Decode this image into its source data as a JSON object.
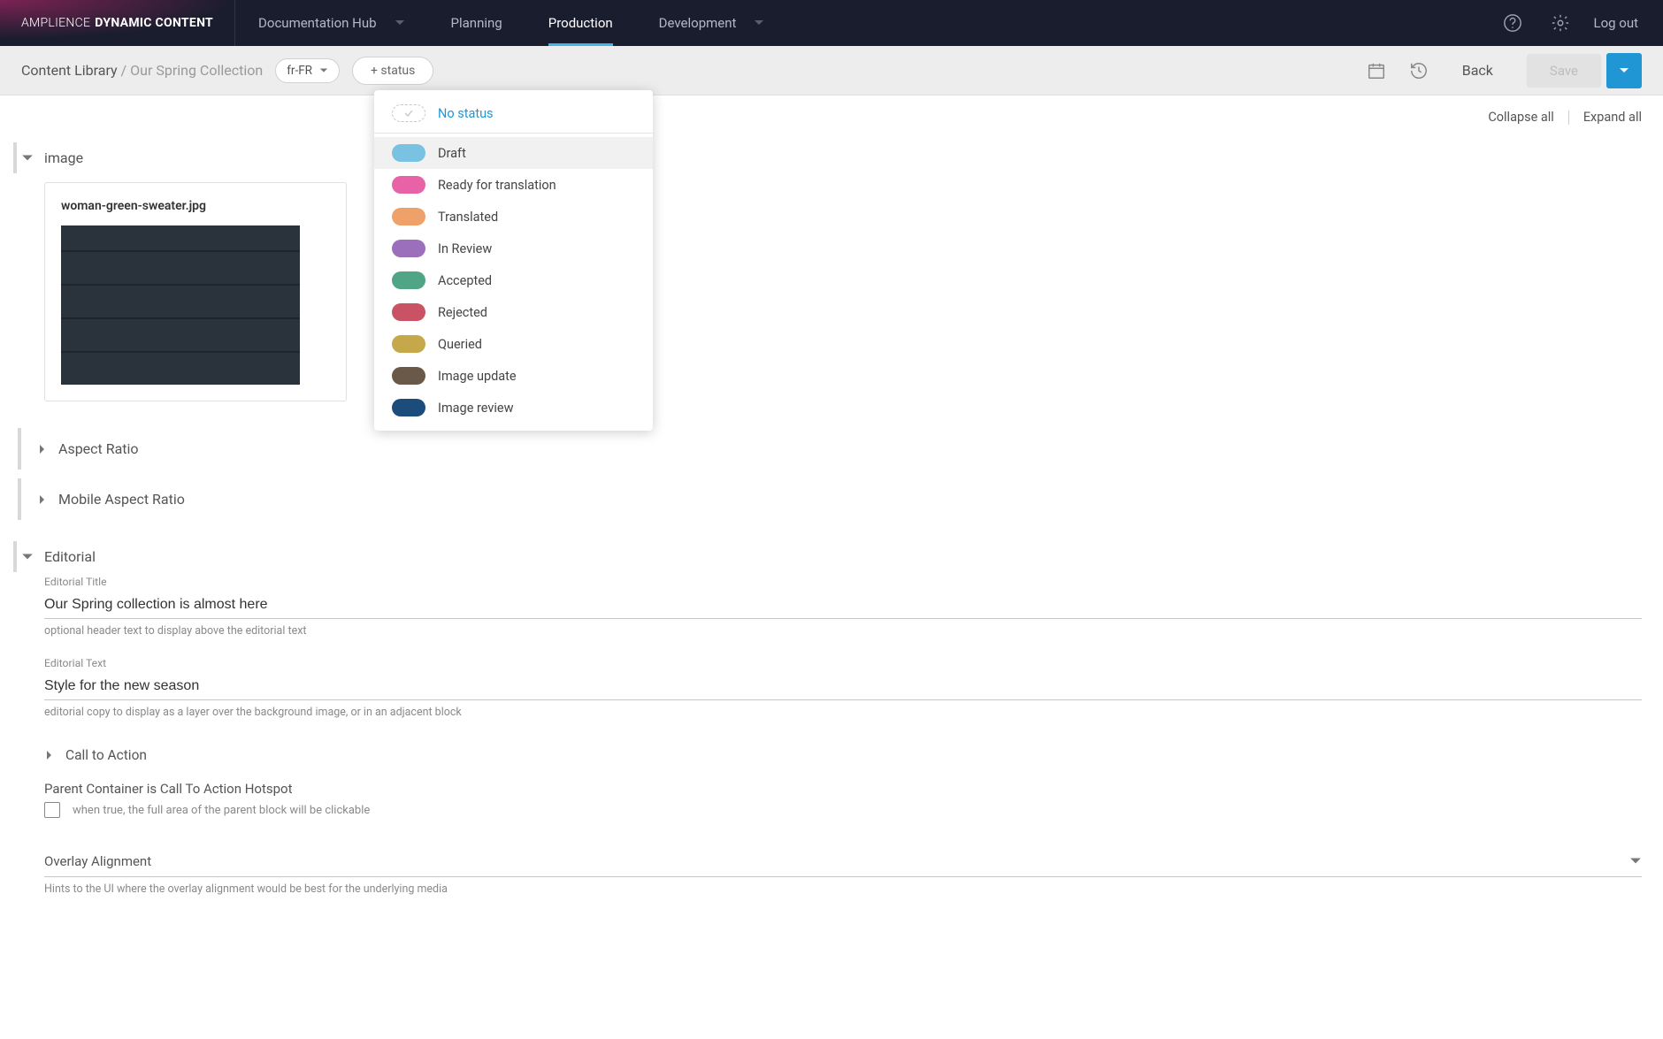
{
  "brand": {
    "thin": "AMPLIENCE",
    "bold": "DYNAMIC CONTENT"
  },
  "nav": {
    "docs": "Documentation Hub",
    "planning": "Planning",
    "production": "Production",
    "development": "Development",
    "logout": "Log out"
  },
  "subheader": {
    "crumb_root": "Content Library",
    "crumb_sep": " / ",
    "crumb_current": "Our Spring Collection",
    "locale": "fr-FR",
    "status_btn": "+ status",
    "back": "Back",
    "save": "Save"
  },
  "status_menu": {
    "no_status": "No status",
    "items": [
      {
        "label": "Draft",
        "color": "#7ac2e2"
      },
      {
        "label": "Ready for translation",
        "color": "#e862a7"
      },
      {
        "label": "Translated",
        "color": "#f0a16a"
      },
      {
        "label": "In Review",
        "color": "#9c6fbd"
      },
      {
        "label": "Accepted",
        "color": "#4fa585"
      },
      {
        "label": "Rejected",
        "color": "#c95364"
      },
      {
        "label": "Queried",
        "color": "#c5a84a"
      },
      {
        "label": "Image update",
        "color": "#6a5848"
      },
      {
        "label": "Image review",
        "color": "#1b4c7c"
      }
    ]
  },
  "collapse": {
    "collapse": "Collapse all",
    "expand": "Expand all"
  },
  "sections": {
    "image": "image",
    "aspect": "Aspect Ratio",
    "mobile_aspect": "Mobile Aspect Ratio",
    "editorial": "Editorial",
    "cta": "Call to Action"
  },
  "image": {
    "filename": "woman-green-sweater.jpg"
  },
  "editorial": {
    "title_label": "Editorial Title",
    "title_value": "Our Spring collection is almost here",
    "title_help": "optional header text to display above the editorial text",
    "text_label": "Editorial Text",
    "text_value": "Style for the new season",
    "text_help": "editorial copy to display as a layer over the background image, or in an adjacent block"
  },
  "hotspot": {
    "title": "Parent Container is Call To Action Hotspot",
    "desc": "when true, the full area of the parent block will be clickable"
  },
  "overlay": {
    "title": "Overlay Alignment",
    "help": "Hints to the UI where the overlay alignment would be best for the underlying media"
  }
}
